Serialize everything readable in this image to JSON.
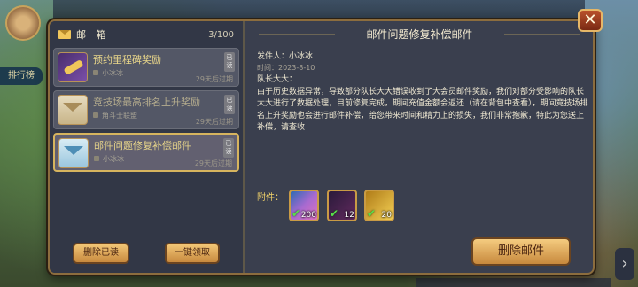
{
  "panel": {
    "header_title": "邮 箱",
    "count": "3/100",
    "close_label": "✕"
  },
  "mails": [
    {
      "title": "预约里程碑奖励",
      "sender": "小冰冰",
      "expire": "29天后过期",
      "tag": "已读",
      "read": false,
      "icon": "scroll-icon"
    },
    {
      "title": "竞技场最高排名上升奖励",
      "sender": "角斗士联盟",
      "expire": "29天后过期",
      "tag": "已读",
      "read": true,
      "icon": "envelope-icon"
    },
    {
      "title": "邮件问题修复补偿邮件",
      "sender": "小冰冰",
      "expire": "29天后过期",
      "tag": "已读",
      "read": false,
      "icon": "envelope-blue-icon"
    }
  ],
  "buttons": {
    "delete_read": "删除已读",
    "claim_all": "一键领取",
    "delete_mail": "删除邮件"
  },
  "detail": {
    "title": "邮件问题修复补偿邮件",
    "sender": "发件人：小冰冰",
    "time": "时间：2023-8-10",
    "greeting": "队长大大：",
    "body": "由于历史数据异常，导致部分队长大大错误收到了大会员邮件奖励，我们对部分受影响的队长大大进行了数据处理，目前修复完成，期间充值金额会返还（请在背包中查看），期间竞技场排名上升奖励也会进行邮件补偿，给您带来时间和精力上的损失，我们非常抱歉，特此为您送上补偿，请查收",
    "attachments_label": "附件：",
    "attachments": [
      {
        "qty": "200",
        "icon": "crystal-icon"
      },
      {
        "qty": "12",
        "icon": "wand-icon"
      },
      {
        "qty": "20",
        "icon": "gold-scroll-icon"
      }
    ]
  },
  "background": {
    "rank_label": "排行榜"
  },
  "colors": {
    "panel_bg": "#3a3f4e",
    "border_gold": "#8c6d3e",
    "button_gold": "#f2c676",
    "unread_title": "#e9d68a"
  }
}
